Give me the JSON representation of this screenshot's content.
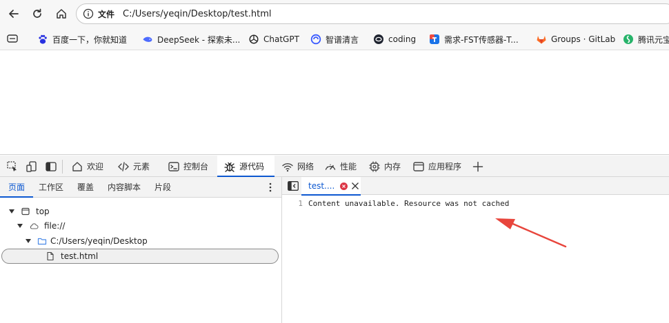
{
  "address_bar": {
    "scheme_label": "文件",
    "url": "C:/Users/yeqin/Desktop/test.html"
  },
  "bookmarks": [
    {
      "label": "百度一下，你就知道",
      "icon": "baidu-paw-icon"
    },
    {
      "label": "DeepSeek - 探索未...",
      "icon": "deepseek-whale-icon"
    },
    {
      "label": "ChatGPT",
      "icon": "chatgpt-knot-icon"
    },
    {
      "label": "智谱清言",
      "icon": "zhipu-icon"
    },
    {
      "label": "coding",
      "icon": "coding-icon"
    },
    {
      "label": "需求-FST传感器-T...",
      "icon": "tapd-icon"
    },
    {
      "label": "Groups · GitLab",
      "icon": "gitlab-fox-icon"
    },
    {
      "label": "腾讯元宝",
      "icon": "yuanbao-icon"
    }
  ],
  "devtools": {
    "tabs": [
      {
        "label": "欢迎",
        "icon": "home-icon"
      },
      {
        "label": "元素",
        "icon": "code-brackets-icon"
      },
      {
        "label": "控制台",
        "icon": "console-icon"
      },
      {
        "label": "源代码",
        "icon": "bug-icon",
        "active": true
      },
      {
        "label": "网络",
        "icon": "wifi-icon"
      },
      {
        "label": "性能",
        "icon": "gauge-icon"
      },
      {
        "label": "内存",
        "icon": "chip-icon"
      },
      {
        "label": "应用程序",
        "icon": "app-window-icon"
      }
    ],
    "sidebar_tabs": [
      "页面",
      "工作区",
      "覆盖",
      "内容脚本",
      "片段"
    ],
    "tree": {
      "top": "top",
      "origin": "file://",
      "folder": "C:/Users/yeqin/Desktop",
      "file": "test.html"
    },
    "editor": {
      "tab_label": "test....",
      "line_number": "1",
      "line_text": "Content unavailable. Resource was not cached"
    }
  },
  "colors": {
    "accent_blue": "#0b57d0",
    "error_red": "#dc3545",
    "annotation_arrow": "#e8453c"
  }
}
